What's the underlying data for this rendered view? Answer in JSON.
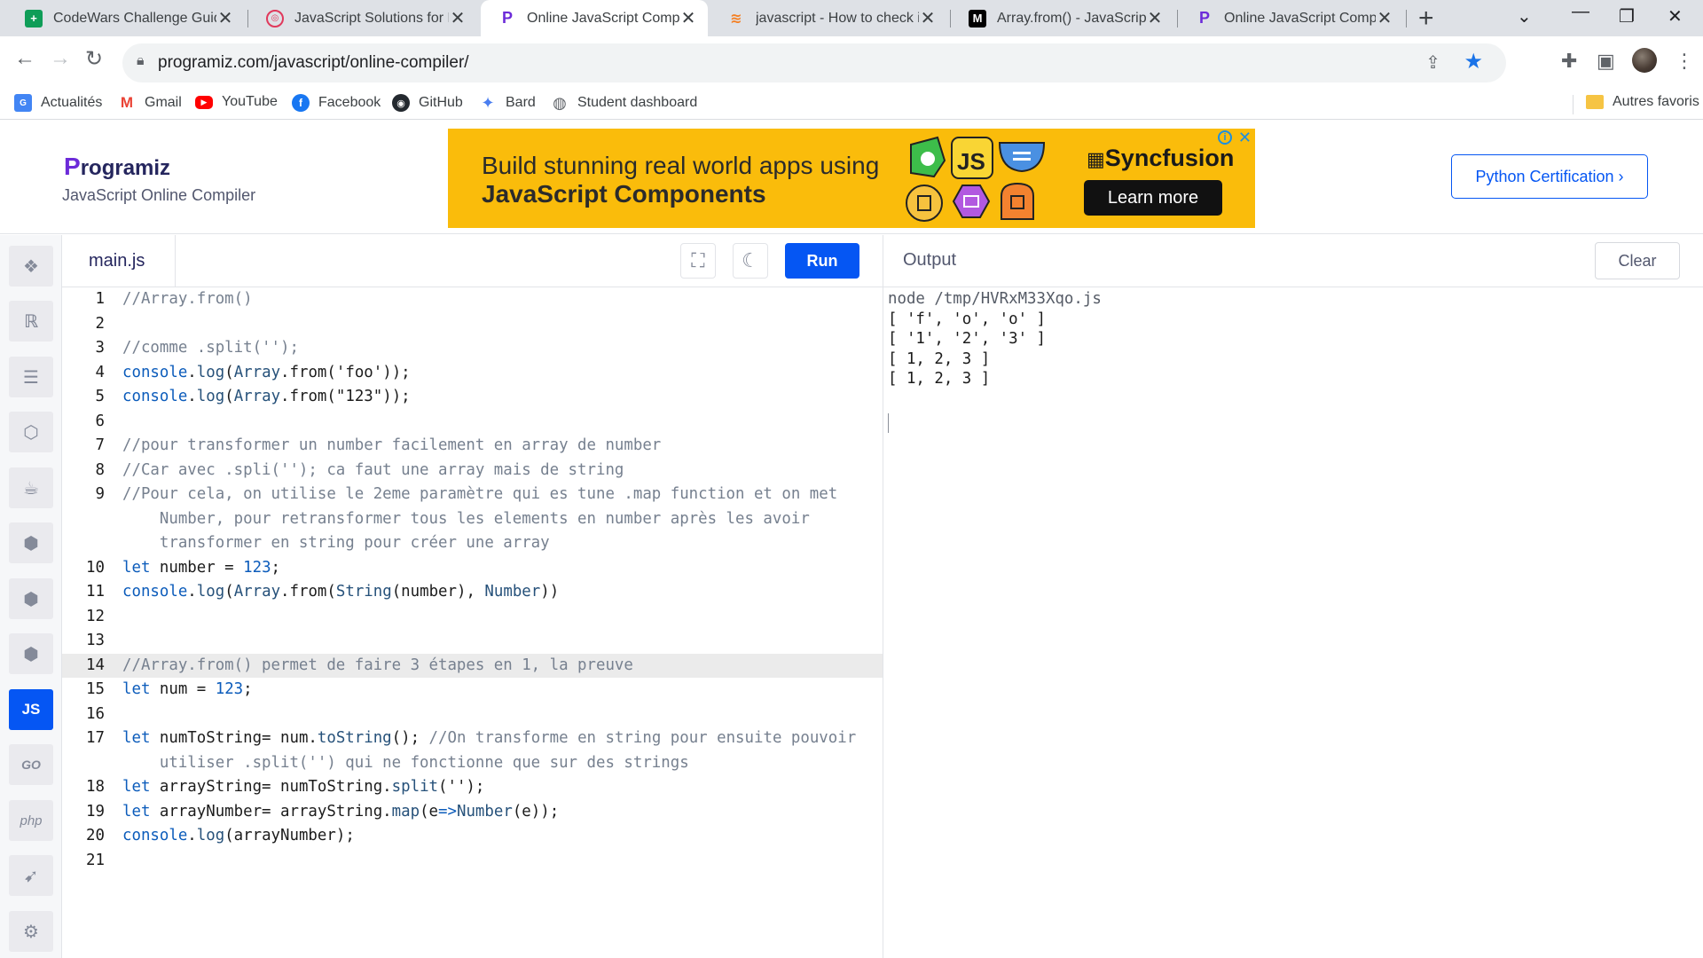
{
  "browser": {
    "tabs": [
      {
        "title": "CodeWars Challenge Guide",
        "icon": "sheets-icon"
      },
      {
        "title": "JavaScript Solutions for Ren",
        "icon": "codewars-icon"
      },
      {
        "title": "Online JavaScript Compiler",
        "icon": "programiz-icon"
      },
      {
        "title": "javascript - How to check if",
        "icon": "stackoverflow-icon"
      },
      {
        "title": "Array.from() - JavaScript | M",
        "icon": "mdn-icon"
      },
      {
        "title": "Online JavaScript Compiler",
        "icon": "programiz-icon"
      }
    ],
    "active_tab": 2,
    "url": "programiz.com/javascript/online-compiler/",
    "bookmarks": [
      {
        "label": "Actualités",
        "icon": "news-icon"
      },
      {
        "label": "Gmail",
        "icon": "gmail-icon"
      },
      {
        "label": "YouTube",
        "icon": "youtube-icon"
      },
      {
        "label": "Facebook",
        "icon": "facebook-icon"
      },
      {
        "label": "GitHub",
        "icon": "github-icon"
      },
      {
        "label": "Bard",
        "icon": "bard-icon"
      },
      {
        "label": "Student dashboard",
        "icon": "globe-icon"
      }
    ],
    "other_bookmarks": "Autres favoris"
  },
  "site": {
    "logo": "rogramiz",
    "logo_initial": "P",
    "subtitle": "JavaScript Online Compiler",
    "cert_button": "Python Certification ›",
    "ad": {
      "line1": "Build stunning real world apps using",
      "line2": "JavaScript Components",
      "brand": "Syncfusion",
      "cta": "Learn more",
      "js_badge": "JS"
    }
  },
  "languages": [
    "python",
    "r",
    "sql",
    "html",
    "java",
    "c",
    "cpp",
    "csharp",
    "JS",
    "GO",
    "php",
    "swift",
    "rust"
  ],
  "active_language": 8,
  "editor": {
    "file_name": "main.js",
    "run_label": "Run",
    "highlighted_line": 14,
    "lines": [
      {
        "n": "1",
        "segs": [
          {
            "t": "//Array.from()",
            "c": "cm"
          }
        ]
      },
      {
        "n": "2",
        "segs": []
      },
      {
        "n": "3",
        "segs": [
          {
            "t": "//comme .split('');",
            "c": "cm"
          }
        ]
      },
      {
        "n": "4",
        "segs": [
          {
            "t": "console",
            "c": "kw"
          },
          {
            "t": ".",
            "c": ""
          },
          {
            "t": "log",
            "c": "fn"
          },
          {
            "t": "(",
            "c": ""
          },
          {
            "t": "Array",
            "c": "fn"
          },
          {
            "t": ".from(",
            "c": ""
          },
          {
            "t": "'foo'",
            "c": "st"
          },
          {
            "t": "));",
            "c": ""
          }
        ]
      },
      {
        "n": "5",
        "segs": [
          {
            "t": "console",
            "c": "kw"
          },
          {
            "t": ".",
            "c": ""
          },
          {
            "t": "log",
            "c": "fn"
          },
          {
            "t": "(",
            "c": ""
          },
          {
            "t": "Array",
            "c": "fn"
          },
          {
            "t": ".from(",
            "c": ""
          },
          {
            "t": "\"123\"",
            "c": "st"
          },
          {
            "t": "));",
            "c": ""
          }
        ]
      },
      {
        "n": "6",
        "segs": []
      },
      {
        "n": "7",
        "segs": [
          {
            "t": "//pour transformer un number facilement en array de number",
            "c": "cm"
          }
        ]
      },
      {
        "n": "8",
        "segs": [
          {
            "t": "//Car avec .spli(''); ca faut une array mais de string",
            "c": "cm"
          }
        ]
      },
      {
        "n": "9",
        "segs": [
          {
            "t": "//Pour cela, on utilise le 2eme paramètre qui es tune .map function et on met",
            "c": "cm"
          }
        ]
      },
      {
        "n": "",
        "segs": [
          {
            "t": "    Number, pour retransformer tous les elements en number après les avoir",
            "c": "cm"
          }
        ]
      },
      {
        "n": "",
        "segs": [
          {
            "t": "    transformer en string pour créer une array",
            "c": "cm"
          }
        ]
      },
      {
        "n": "10",
        "segs": [
          {
            "t": "let",
            "c": "kw"
          },
          {
            "t": " number = ",
            "c": ""
          },
          {
            "t": "123",
            "c": "kw"
          },
          {
            "t": ";",
            "c": ""
          }
        ]
      },
      {
        "n": "11",
        "segs": [
          {
            "t": "console",
            "c": "kw"
          },
          {
            "t": ".",
            "c": ""
          },
          {
            "t": "log",
            "c": "fn"
          },
          {
            "t": "(",
            "c": ""
          },
          {
            "t": "Array",
            "c": "fn"
          },
          {
            "t": ".from(",
            "c": ""
          },
          {
            "t": "String",
            "c": "fn"
          },
          {
            "t": "(number), ",
            "c": ""
          },
          {
            "t": "Number",
            "c": "fn"
          },
          {
            "t": "))",
            "c": ""
          }
        ]
      },
      {
        "n": "12",
        "segs": []
      },
      {
        "n": "13",
        "segs": []
      },
      {
        "n": "14",
        "segs": [
          {
            "t": "//Array.from() permet de faire 3 étapes en 1, la preuve",
            "c": "cm"
          }
        ]
      },
      {
        "n": "15",
        "segs": [
          {
            "t": "let",
            "c": "kw"
          },
          {
            "t": " num = ",
            "c": ""
          },
          {
            "t": "123",
            "c": "kw"
          },
          {
            "t": ";",
            "c": ""
          }
        ]
      },
      {
        "n": "16",
        "segs": []
      },
      {
        "n": "17",
        "segs": [
          {
            "t": "let",
            "c": "kw"
          },
          {
            "t": " numToString= num.",
            "c": ""
          },
          {
            "t": "toString",
            "c": "fn"
          },
          {
            "t": "(); ",
            "c": ""
          },
          {
            "t": "//On transforme en string pour ensuite pouvoir",
            "c": "cm"
          }
        ]
      },
      {
        "n": "",
        "segs": [
          {
            "t": "    utiliser .split('') qui ne fonctionne que sur des strings",
            "c": "cm"
          }
        ]
      },
      {
        "n": "18",
        "segs": [
          {
            "t": "let",
            "c": "kw"
          },
          {
            "t": " arrayString= numToString.",
            "c": ""
          },
          {
            "t": "split",
            "c": "fn"
          },
          {
            "t": "('');",
            "c": ""
          }
        ]
      },
      {
        "n": "19",
        "segs": [
          {
            "t": "let",
            "c": "kw"
          },
          {
            "t": " arrayNumber= arrayString.",
            "c": ""
          },
          {
            "t": "map",
            "c": "fn"
          },
          {
            "t": "(e",
            "c": ""
          },
          {
            "t": "=>",
            "c": "kw"
          },
          {
            "t": "Number",
            "c": "fn"
          },
          {
            "t": "(e));",
            "c": ""
          }
        ]
      },
      {
        "n": "20",
        "segs": [
          {
            "t": "console",
            "c": "kw"
          },
          {
            "t": ".",
            "c": ""
          },
          {
            "t": "log",
            "c": "fn"
          },
          {
            "t": "(arrayNumber);",
            "c": ""
          }
        ]
      },
      {
        "n": "21",
        "segs": []
      }
    ]
  },
  "output": {
    "title": "Output",
    "clear_label": "Clear",
    "command": "node /tmp/HVRxM33Xqo.js",
    "lines": [
      "[ 'f', 'o', 'o' ]",
      "[ '1', '2', '3' ]",
      "[ 1, 2, 3 ]",
      "[ 1, 2, 3 ]"
    ]
  }
}
